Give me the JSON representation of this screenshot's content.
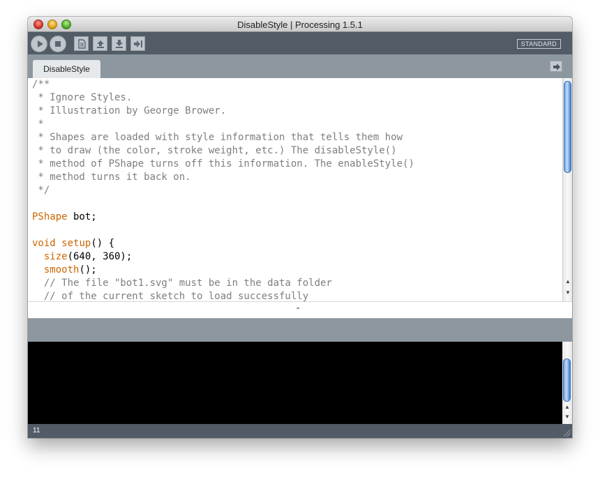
{
  "window": {
    "title": "DisableStyle | Processing 1.5.1"
  },
  "toolbar": {
    "buttons": [
      {
        "name": "run",
        "icon": "play-icon"
      },
      {
        "name": "stop",
        "icon": "stop-icon"
      },
      {
        "name": "new",
        "icon": "new-file-icon"
      },
      {
        "name": "open",
        "icon": "open-arrow-up-icon"
      },
      {
        "name": "save",
        "icon": "save-arrow-down-icon"
      },
      {
        "name": "export",
        "icon": "export-arrow-right-icon"
      }
    ],
    "mode": "STANDARD"
  },
  "tabs": [
    {
      "label": "DisableStyle",
      "active": true
    }
  ],
  "editor": {
    "lines": [
      "/**",
      " * Ignore Styles.",
      " * Illustration by George Brower.",
      " *",
      " * Shapes are loaded with style information that tells them how",
      " * to draw (the color, stroke weight, etc.) The disableStyle()",
      " * method of PShape turns off this information. The enableStyle()",
      " * method turns it back on.",
      " */",
      "",
      "PShape bot;",
      "",
      "void setup() {",
      "  size(640, 360);",
      "  smooth();",
      "  // The file \"bot1.svg\" must be in the data folder",
      "  // of the current sketch to load successfully"
    ]
  },
  "console": {
    "text": ""
  },
  "status": {
    "line_number": "11"
  },
  "colors": {
    "keyword": "#cc6600",
    "comment": "#7e7e7e",
    "toolbar": "#515c66",
    "tab_strip": "#8d979f"
  }
}
